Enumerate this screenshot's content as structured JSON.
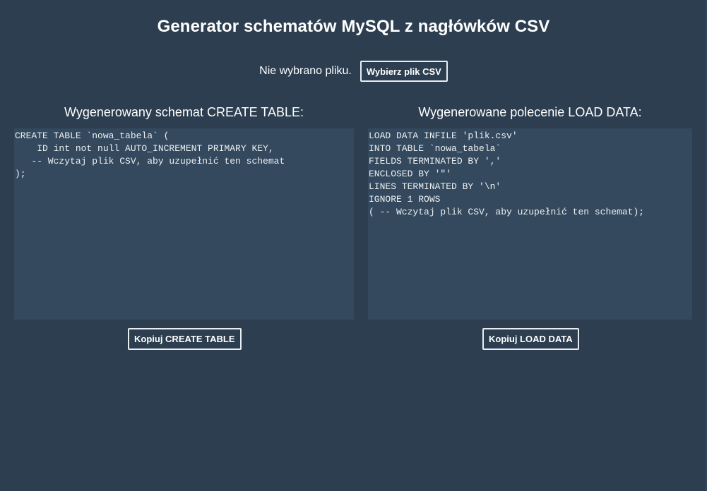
{
  "header": {
    "title": "Generator schematów MySQL z nagłówków CSV"
  },
  "file_picker": {
    "status_text": "Nie wybrano pliku.",
    "button_label": "Wybierz plik CSV"
  },
  "create_panel": {
    "title": "Wygenerowany schemat CREATE TABLE:",
    "code": "CREATE TABLE `nowa_tabela` (\n    ID int not null AUTO_INCREMENT PRIMARY KEY,\n   -- Wczytaj plik CSV, aby uzupełnić ten schemat\n);",
    "copy_label": "Kopiuj CREATE TABLE"
  },
  "load_panel": {
    "title": "Wygenerowane polecenie LOAD DATA:",
    "code": "LOAD DATA INFILE 'plik.csv'\nINTO TABLE `nowa_tabela`\nFIELDS TERMINATED BY ','\nENCLOSED BY '\"'\nLINES TERMINATED BY '\\n'\nIGNORE 1 ROWS\n( -- Wczytaj plik CSV, aby uzupełnić ten schemat);",
    "copy_label": "Kopiuj LOAD DATA"
  },
  "colors": {
    "background": "#2c3e50",
    "code_background": "#34495e",
    "text": "#ffffff"
  }
}
